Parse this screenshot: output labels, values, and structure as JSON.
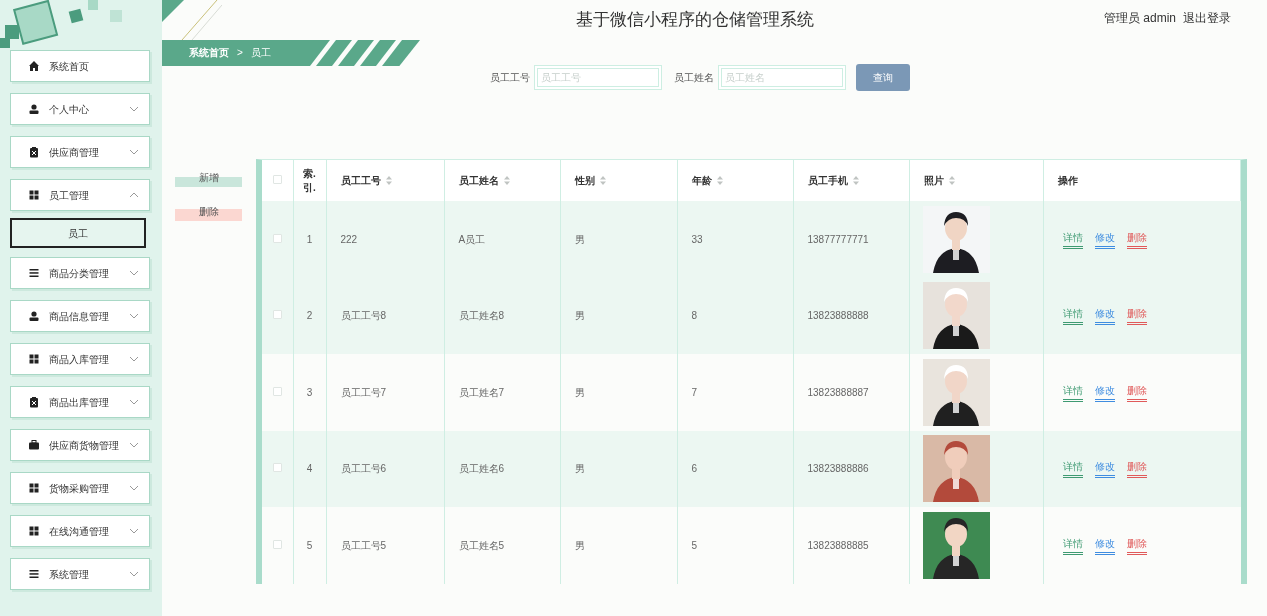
{
  "header": {
    "title": "基于微信小程序的仓储管理系统",
    "user": "管理员 admin",
    "logout": "退出登录"
  },
  "sidebar": {
    "items": [
      {
        "label": "系统首页",
        "kind": "link"
      },
      {
        "label": "个人中心",
        "kind": "menu",
        "expanded": false
      },
      {
        "label": "供应商管理",
        "kind": "menu",
        "expanded": false
      },
      {
        "label": "员工管理",
        "kind": "menu",
        "expanded": true,
        "children": [
          {
            "label": "员工",
            "selected": true
          }
        ]
      },
      {
        "label": "商品分类管理",
        "kind": "menu",
        "expanded": false
      },
      {
        "label": "商品信息管理",
        "kind": "menu",
        "expanded": false
      },
      {
        "label": "商品入库管理",
        "kind": "menu",
        "expanded": false
      },
      {
        "label": "商品出库管理",
        "kind": "menu",
        "expanded": false
      },
      {
        "label": "供应商货物管理",
        "kind": "menu",
        "expanded": false
      },
      {
        "label": "货物采购管理",
        "kind": "menu",
        "expanded": false
      },
      {
        "label": "在线沟通管理",
        "kind": "menu",
        "expanded": false
      },
      {
        "label": "系统管理",
        "kind": "menu",
        "expanded": false
      }
    ]
  },
  "breadcrumb": [
    "系统首页",
    ">",
    "员工"
  ],
  "search": {
    "fields": [
      {
        "label": "员工工号",
        "placeholder": "员工工号"
      },
      {
        "label": "员工姓名",
        "placeholder": "员工姓名"
      }
    ],
    "button": "查询"
  },
  "actions": [
    {
      "label": "新增",
      "kind": "add"
    },
    {
      "label": "删除",
      "kind": "delete"
    }
  ],
  "table": {
    "select_all": {
      "checked": false
    },
    "columns": [
      {
        "label": "索.\n引.",
        "sortable": false
      },
      {
        "label": "员工工号",
        "sortable": true
      },
      {
        "label": "员工姓名",
        "sortable": true
      },
      {
        "label": "性别",
        "sortable": true
      },
      {
        "label": "年龄",
        "sortable": true
      },
      {
        "label": "员工手机",
        "sortable": true
      },
      {
        "label": "照片",
        "sortable": true
      },
      {
        "label": "操作",
        "sortable": false
      }
    ],
    "rows": [
      {
        "checked": false,
        "hovered": true,
        "cells": [
          "1",
          "222",
          "A员工",
          "男",
          "33",
          "13877777771"
        ],
        "actions": [
          "详情",
          "修改",
          "删除"
        ]
      },
      {
        "checked": false,
        "hovered": false,
        "cells": [
          "2",
          "员工工号8",
          "员工姓名8",
          "男",
          "8",
          "13823888888"
        ],
        "actions": [
          "详情",
          "修改",
          "删除"
        ]
      },
      {
        "checked": false,
        "hovered": false,
        "cells": [
          "3",
          "员工工号7",
          "员工姓名7",
          "男",
          "7",
          "13823888887"
        ],
        "actions": [
          "详情",
          "修改",
          "删除"
        ]
      },
      {
        "checked": false,
        "hovered": false,
        "cells": [
          "4",
          "员工工号6",
          "员工姓名6",
          "男",
          "6",
          "13823888886"
        ],
        "actions": [
          "详情",
          "修改",
          "删除"
        ]
      },
      {
        "checked": false,
        "hovered": false,
        "cells": [
          "5",
          "员工工号5",
          "员工姓名5",
          "男",
          "5",
          "13823888885"
        ],
        "actions": [
          "详情",
          "修改",
          "删除"
        ]
      }
    ]
  }
}
